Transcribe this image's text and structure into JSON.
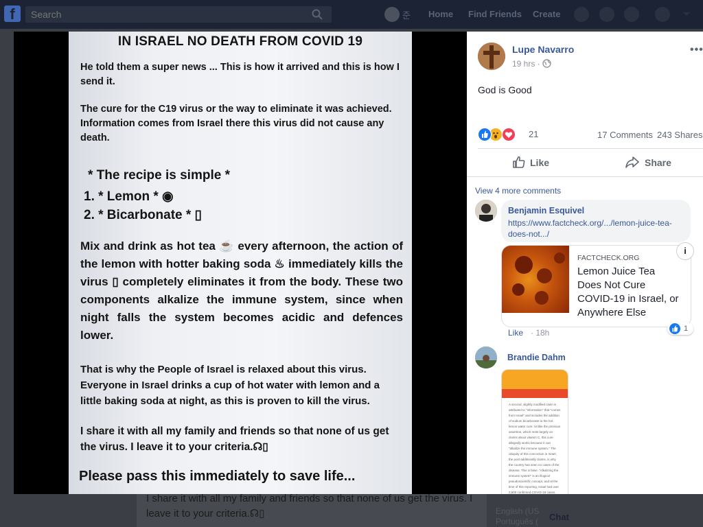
{
  "topbar": {
    "logo": "f",
    "search_placeholder": "Search",
    "user_name": "준",
    "nav": [
      "Home",
      "Find Friends",
      "Create"
    ]
  },
  "photo": {
    "title": "IN ISRAEL NO DEATH FROM COVID 19",
    "para1": "He told them a super news ... This is how it arrived and this is how I send it.",
    "para2": "The cure for the C19 virus or the way to eliminate it was achieved. Information comes from Israel there this virus did not cause any death.",
    "recipe_heading": "* The recipe is simple *",
    "recipe_item1": "1. * Lemon * ◉",
    "recipe_item2": "2. * Bicarbonate * ▯",
    "para3": "Mix and drink as hot tea ☕ every afternoon, the action of the lemon with hotter baking soda ♨ immediately kills the virus ▯ completely eliminates it from the body.  These two components alkalize the immune system, since when night falls the system becomes acidic and defences lower.",
    "para4": "That is why the People of Israel is relaxed about this virus. Everyone in Israel drinks a cup of hot water with lemon and a little baking soda at night, as this is proven to kill the virus.",
    "para5": "I share it with all my family and friends so that none of us get the virus.  I leave it to your criteria.☊▯",
    "closing": "Please pass this immediately to save life..."
  },
  "background_post": {
    "text": "I share it with all my family and friends so that none of us get the virus.  I leave it to your criteria.☊▯"
  },
  "chat": {
    "label": "Chat",
    "lang1": "English (US",
    "lang2": "Português ("
  },
  "post": {
    "author": "Lupe Navarro",
    "time": "19 hrs ·",
    "text": "God is Good",
    "reaction_count": "21",
    "comments": "17 Comments",
    "shares": "243 Shares",
    "like_label": "Like",
    "share_label": "Share",
    "more_label": "•••"
  },
  "comments": {
    "view_more": "View 4 more comments",
    "c1": {
      "name": "Benjamin Esquivel",
      "link": "https://www.factcheck.org/.../lemon-juice-tea-does-not.../",
      "card_site": "FACTCHECK.ORG",
      "card_title": "Lemon Juice Tea Does Not Cure COVID-19 in Israel, or Anywhere Else",
      "info": "i",
      "like": "Like",
      "time": "· 18h",
      "react_count": "1"
    },
    "c2": {
      "name": "Brandie Dahm",
      "shot_text": "A second, slightly modified claim is attributed to \"information\" that \"comes from Israel\" and includes the addition of sodium bicarbonate to the hot lemon water cure. Unlike the previous assertion, which rests largely on claims about vitamin C, this cure allegedly works because it can \"alkalize the immune system.\" The ubiquity of this concoction in Israel, the post additionally claims, is why the country has seen no cases of the disease. This is false. \"Alkalizing the immune system\" is an illogical pseudoscientific concept, and at the time of this reporting, Israel had over 2,500 confirmed COVID-19 cases."
    }
  },
  "colors": {
    "topbar": "#1b2334",
    "link": "#385898",
    "like_blue": "#1877f2",
    "love_red": "#f33e58",
    "wow_yellow": "#f7b125"
  }
}
